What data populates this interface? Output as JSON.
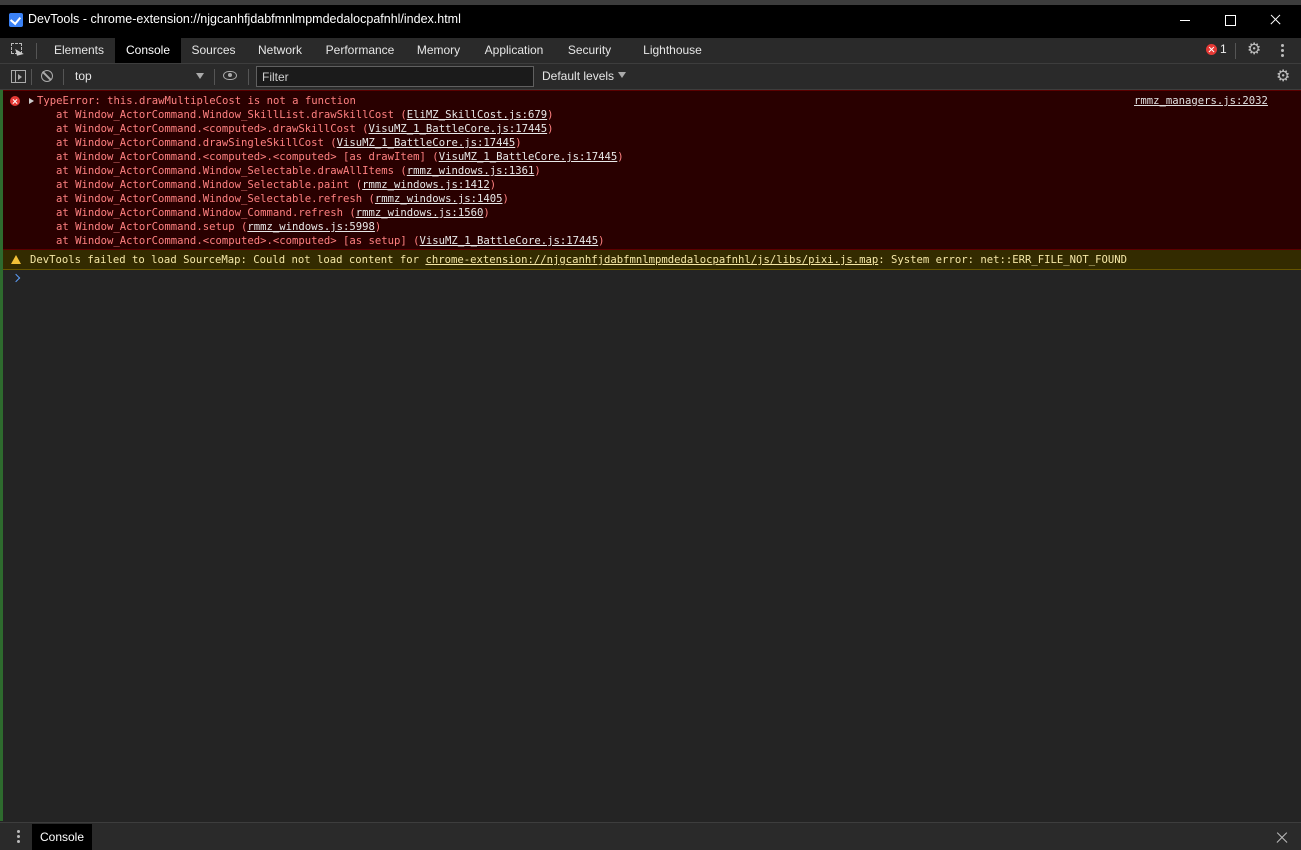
{
  "window": {
    "title": "DevTools - chrome-extension://njgcanhfjdabfmnlmpmdedalocpafnhl/index.html"
  },
  "tabs": [
    {
      "label": "Elements"
    },
    {
      "label": "Console"
    },
    {
      "label": "Sources"
    },
    {
      "label": "Network"
    },
    {
      "label": "Performance"
    },
    {
      "label": "Memory"
    },
    {
      "label": "Application"
    },
    {
      "label": "Security"
    },
    {
      "label": "Lighthouse"
    }
  ],
  "active_tab": "Console",
  "error_count": "1",
  "console_toolbar": {
    "context": "top",
    "filter_placeholder": "Filter",
    "levels": "Default levels"
  },
  "error": {
    "headline": "TypeError: this.drawMultipleCost is not a function",
    "source": "rmmz_managers.js:2032",
    "frames": [
      {
        "prefix": "at Window_ActorCommand.Window_SkillList.drawSkillCost (",
        "link": "EliMZ_SkillCost.js:679",
        "suffix": ")"
      },
      {
        "prefix": "at Window_ActorCommand.<computed>.drawSkillCost (",
        "link": "VisuMZ_1_BattleCore.js:17445",
        "suffix": ")"
      },
      {
        "prefix": "at Window_ActorCommand.drawSingleSkillCost (",
        "link": "VisuMZ_1_BattleCore.js:17445",
        "suffix": ")"
      },
      {
        "prefix": "at Window_ActorCommand.<computed>.<computed> [as drawItem] (",
        "link": "VisuMZ_1_BattleCore.js:17445",
        "suffix": ")"
      },
      {
        "prefix": "at Window_ActorCommand.Window_Selectable.drawAllItems (",
        "link": "rmmz_windows.js:1361",
        "suffix": ")"
      },
      {
        "prefix": "at Window_ActorCommand.Window_Selectable.paint (",
        "link": "rmmz_windows.js:1412",
        "suffix": ")"
      },
      {
        "prefix": "at Window_ActorCommand.Window_Selectable.refresh (",
        "link": "rmmz_windows.js:1405",
        "suffix": ")"
      },
      {
        "prefix": "at Window_ActorCommand.Window_Command.refresh (",
        "link": "rmmz_windows.js:1560",
        "suffix": ")"
      },
      {
        "prefix": "at Window_ActorCommand.setup (",
        "link": "rmmz_windows.js:5998",
        "suffix": ")"
      },
      {
        "prefix": "at Window_ActorCommand.<computed>.<computed> [as setup] (",
        "link": "VisuMZ_1_BattleCore.js:17445",
        "suffix": ")"
      }
    ]
  },
  "warning": {
    "prefix": "DevTools failed to load SourceMap: Could not load content for ",
    "link": "chrome-extension://njgcanhfjdabfmnlmpmdedalocpafnhl/js/libs/pixi.js.map",
    "suffix": ": System error: net::ERR_FILE_NOT_FOUND"
  },
  "drawer": {
    "tab": "Console"
  },
  "icons": {
    "title": "devtools-logo-icon",
    "inspect": "inspect-element-icon",
    "settings": "gear-icon",
    "more": "kebab-menu-icon",
    "sidebar": "show-sidebar-icon",
    "clear": "clear-console-icon",
    "live_expression": "eye-icon",
    "error": "error-icon",
    "warning": "warning-icon"
  },
  "colors": {
    "error_bg": "#290000",
    "error_text": "#ff8080",
    "warning_bg": "#332b00",
    "warning_text": "#f5e7a6",
    "accent": "#3b82f6"
  }
}
